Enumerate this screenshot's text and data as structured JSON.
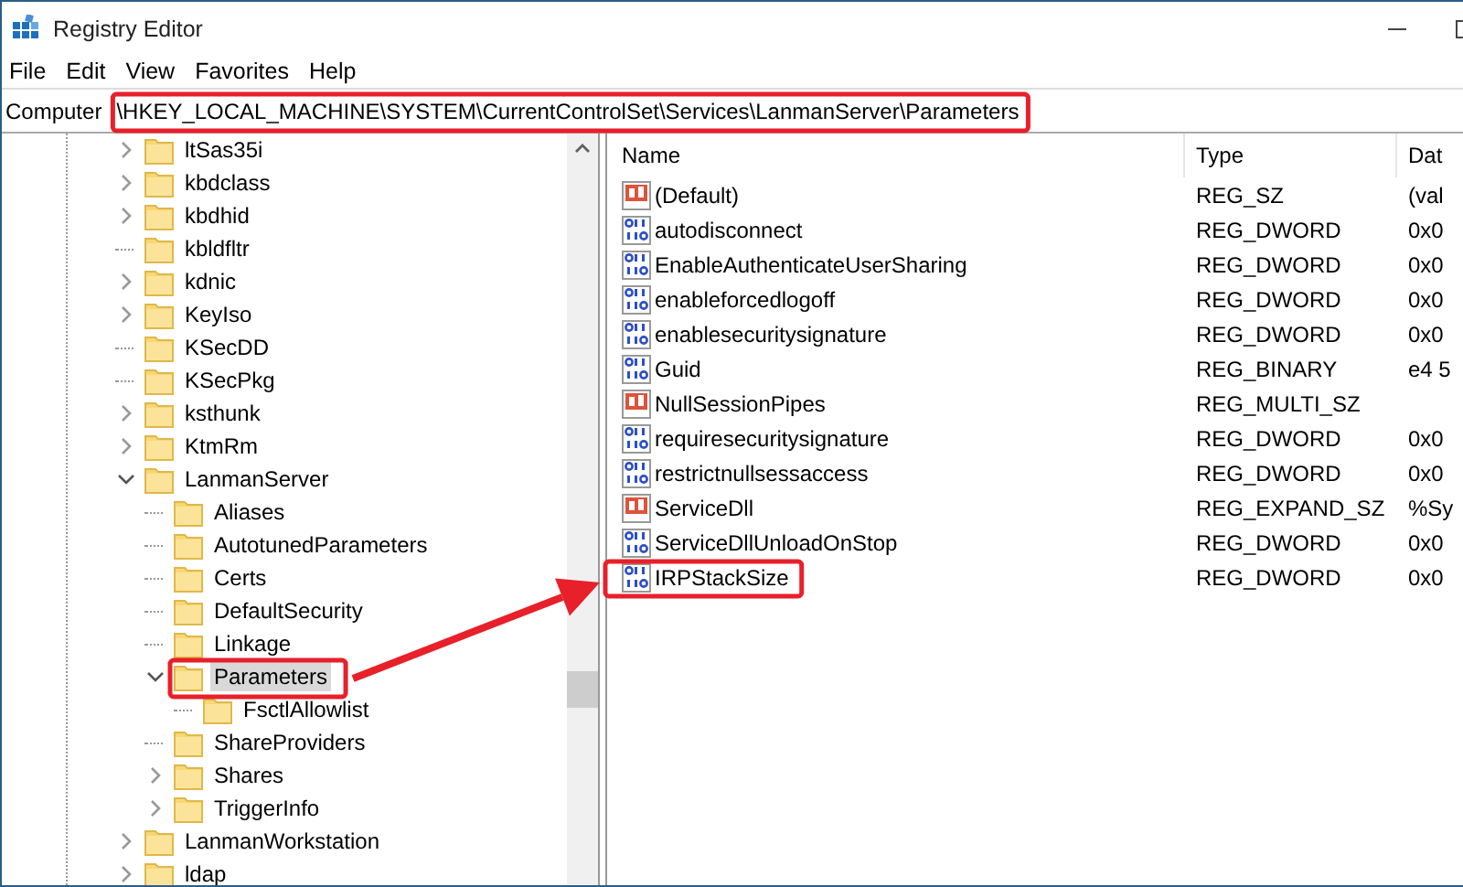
{
  "window": {
    "title": "Registry Editor"
  },
  "menu": [
    "File",
    "Edit",
    "View",
    "Favorites",
    "Help"
  ],
  "address": {
    "root": "Computer",
    "path": "\\HKEY_LOCAL_MACHINE\\SYSTEM\\CurrentControlSet\\Services\\LanmanServer\\Parameters"
  },
  "tree": [
    {
      "label": "ltSas35i",
      "expanded": false,
      "selected": false
    },
    {
      "label": "kbdclass",
      "expanded": false,
      "selected": false
    },
    {
      "label": "kbdhid",
      "expanded": false,
      "selected": false
    },
    {
      "label": "kbldfltr",
      "selected": false
    },
    {
      "label": "kdnic",
      "expanded": false,
      "selected": false
    },
    {
      "label": "KeyIso",
      "expanded": false,
      "selected": false
    },
    {
      "label": "KSecDD",
      "selected": false
    },
    {
      "label": "KSecPkg",
      "selected": false
    },
    {
      "label": "ksthunk",
      "expanded": false,
      "selected": false
    },
    {
      "label": "KtmRm",
      "expanded": false,
      "selected": false
    },
    {
      "label": "LanmanServer",
      "expanded": true,
      "selected": false,
      "children": [
        {
          "label": "Aliases",
          "selected": false
        },
        {
          "label": "AutotunedParameters",
          "selected": false
        },
        {
          "label": "Certs",
          "selected": false
        },
        {
          "label": "DefaultSecurity",
          "selected": false
        },
        {
          "label": "Linkage",
          "selected": false
        },
        {
          "label": "Parameters",
          "expanded": true,
          "selected": true,
          "children": [
            {
              "label": "FsctlAllowlist",
              "selected": false
            }
          ]
        },
        {
          "label": "ShareProviders",
          "selected": false
        },
        {
          "label": "Shares",
          "expanded": false,
          "selected": false
        },
        {
          "label": "TriggerInfo",
          "expanded": false,
          "selected": false
        }
      ]
    },
    {
      "label": "LanmanWorkstation",
      "expanded": false,
      "selected": false
    },
    {
      "label": "ldap",
      "expanded": false,
      "selected": false
    }
  ],
  "table": {
    "columns": [
      "Name",
      "Type",
      "Dat"
    ],
    "rows": [
      {
        "kind": "string",
        "name": "(Default)",
        "type": "REG_SZ",
        "data": "(val"
      },
      {
        "kind": "binary",
        "name": "autodisconnect",
        "type": "REG_DWORD",
        "data": "0x0"
      },
      {
        "kind": "binary",
        "name": "EnableAuthenticateUserSharing",
        "type": "REG_DWORD",
        "data": "0x0"
      },
      {
        "kind": "binary",
        "name": "enableforcedlogoff",
        "type": "REG_DWORD",
        "data": "0x0"
      },
      {
        "kind": "binary",
        "name": "enablesecuritysignature",
        "type": "REG_DWORD",
        "data": "0x0"
      },
      {
        "kind": "binary",
        "name": "Guid",
        "type": "REG_BINARY",
        "data": "e4 5"
      },
      {
        "kind": "string",
        "name": "NullSessionPipes",
        "type": "REG_MULTI_SZ"
      },
      {
        "kind": "binary",
        "name": "requiresecuritysignature",
        "type": "REG_DWORD",
        "data": "0x0"
      },
      {
        "kind": "binary",
        "name": "restrictnullsessaccess",
        "type": "REG_DWORD",
        "data": "0x0"
      },
      {
        "kind": "string",
        "name": "ServiceDll",
        "type": "REG_EXPAND_SZ",
        "data": "%Sy"
      },
      {
        "kind": "binary",
        "name": "ServiceDllUnloadOnStop",
        "type": "REG_DWORD",
        "data": "0x0"
      },
      {
        "kind": "binary",
        "name": "IRPStackSize",
        "type": "REG_DWORD",
        "data": "0x0"
      }
    ]
  }
}
